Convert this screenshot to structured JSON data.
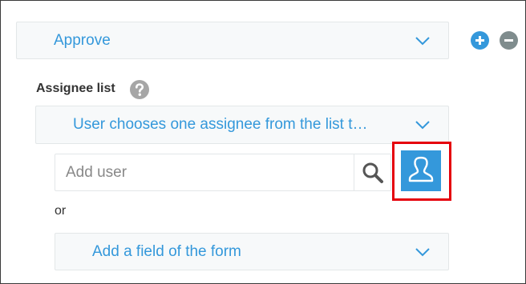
{
  "colors": {
    "accent": "#3498db",
    "remove": "#7f8c8d",
    "highlight": "#e5000b",
    "field_bg": "#f7f9fa",
    "help": "#a6a6a6"
  },
  "process_step": {
    "action_select": {
      "value": "Approve",
      "icon": "chevron-down-icon"
    },
    "add_icon": "plus-icon",
    "remove_icon": "minus-icon"
  },
  "assignee": {
    "label": "Assignee list",
    "help_icon": "question-icon",
    "mode_select": {
      "value": "User chooses one assignee from the list t…",
      "icon": "chevron-down-icon"
    },
    "user_input": {
      "value": "",
      "placeholder": "Add user"
    },
    "search_icon": "search-icon",
    "user_picker_icon": "user-icon",
    "or_text": "or",
    "form_field_select": {
      "value": "Add a field of the form",
      "icon": "chevron-down-icon"
    }
  }
}
